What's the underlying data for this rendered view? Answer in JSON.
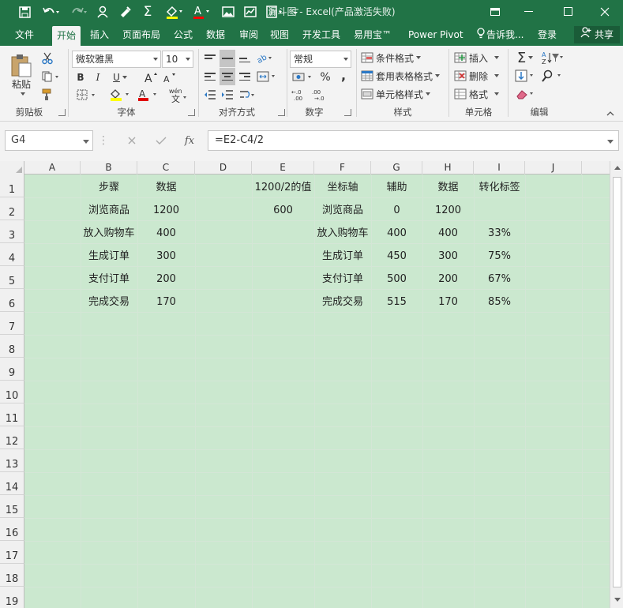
{
  "window": {
    "title": "漏斗图 - Excel(产品激活失败)"
  },
  "tabs": [
    {
      "label": "文件"
    },
    {
      "label": "开始"
    },
    {
      "label": "插入"
    },
    {
      "label": "页面布局"
    },
    {
      "label": "公式"
    },
    {
      "label": "数据"
    },
    {
      "label": "审阅"
    },
    {
      "label": "视图"
    },
    {
      "label": "开发工具"
    },
    {
      "label": "易用宝™"
    },
    {
      "label": "Power Pivot"
    },
    {
      "label": "告诉我..."
    },
    {
      "label": "登录"
    }
  ],
  "share_label": "共享",
  "ribbon": {
    "paste_label": "粘贴",
    "font_name": "微软雅黑",
    "font_size": "10",
    "bold": "B",
    "italic": "I",
    "underline": "U",
    "number_format": "常规",
    "percent": "%",
    "comma": ",",
    "cond_format": "条件格式",
    "table_format": "套用表格格式",
    "cell_style": "单元格样式",
    "insert": "插入",
    "delete": "删除",
    "format": "格式",
    "groups": {
      "clipboard": "剪贴板",
      "font": "字体",
      "alignment": "对齐方式",
      "number": "数字",
      "styles": "样式",
      "cells": "单元格",
      "editing": "编辑"
    }
  },
  "formula_bar": {
    "name_box": "G4",
    "formula": "=E2-C4/2",
    "fx": "fx"
  },
  "sheet": {
    "columns": [
      "A",
      "B",
      "C",
      "D",
      "E",
      "F",
      "G",
      "H",
      "I",
      "J"
    ],
    "rows": [
      "1",
      "2",
      "3",
      "4",
      "5",
      "6",
      "7",
      "8",
      "9",
      "10",
      "11",
      "12",
      "13",
      "14",
      "15",
      "16",
      "17",
      "18",
      "19"
    ],
    "cells": {
      "B1": "步骤",
      "C1": "数据",
      "E1": "1200/2的值",
      "F1": "坐标轴",
      "G1": "辅助",
      "H1": "数据",
      "I1": "转化标签",
      "B2": "浏览商品",
      "C2": "1200",
      "E2": "600",
      "F2": "浏览商品",
      "G2": "0",
      "H2": "1200",
      "B3": "放入购物车",
      "C3": "400",
      "F3": "放入购物车",
      "G3": "400",
      "H3": "400",
      "I3": "33%",
      "B4": "生成订单",
      "C4": "300",
      "F4": "生成订单",
      "G4": "450",
      "H4": "300",
      "I4": "75%",
      "B5": "支付订单",
      "C5": "200",
      "F5": "支付订单",
      "G5": "500",
      "H5": "200",
      "I5": "67%",
      "B6": "完成交易",
      "C6": "170",
      "F6": "完成交易",
      "G6": "515",
      "H6": "170",
      "I6": "85%"
    }
  },
  "colors": {
    "excel_green": "#217346",
    "sheet_fill": "#cbe8cf"
  }
}
